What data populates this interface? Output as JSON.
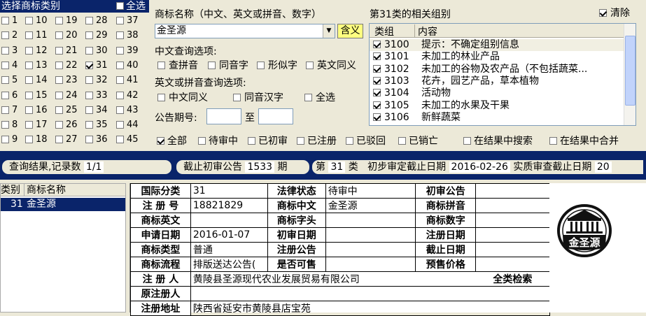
{
  "class_selector": {
    "header": "选择商标类别",
    "select_all": "全选",
    "classes": [
      "1",
      "2",
      "3",
      "4",
      "5",
      "6",
      "7",
      "8",
      "9",
      "10",
      "11",
      "12",
      "13",
      "14",
      "15",
      "16",
      "17",
      "18",
      "19",
      "20",
      "21",
      "22",
      "23",
      "24",
      "25",
      "26",
      "27",
      "28",
      "29",
      "30",
      "31",
      "32",
      "33",
      "34",
      "35",
      "36",
      "37",
      "38",
      "39",
      "40",
      "41",
      "42",
      "43",
      "44",
      "45"
    ],
    "checked_class": "31"
  },
  "query": {
    "name_label": "商标名称（中文、英文或拼音、数字）",
    "name_value": "金圣源",
    "meaning_button": "含义",
    "cn_options_label": "中文查询选项:",
    "cn_options": [
      "查拼音",
      "同音字",
      "形似字",
      "英文同义"
    ],
    "en_options_label": "英文或拼音查询选项:",
    "en_options": [
      "中文同义",
      "同音汉字",
      "全选"
    ],
    "issue_label": "公告期号:",
    "issue_to": "至"
  },
  "groups": {
    "title": "第31类的相关组别",
    "clear": "清除",
    "head_group": "类组",
    "head_content": "内容",
    "rows": [
      {
        "code": "3100",
        "text": "提示：不确定组别信息"
      },
      {
        "code": "3101",
        "text": "未加工的林业产品"
      },
      {
        "code": "3102",
        "text": "未加工的谷物及农产品（不包括蔬菜..."
      },
      {
        "code": "3103",
        "text": "花卉，园艺产品，草本植物"
      },
      {
        "code": "3104",
        "text": "活动物"
      },
      {
        "code": "3105",
        "text": "未加工的水果及干果"
      },
      {
        "code": "3106",
        "text": "新鲜蔬菜"
      }
    ]
  },
  "filters": [
    "全部",
    "待审中",
    "已初审",
    "已注册",
    "已驳回",
    "已销亡",
    "在结果中搜索",
    "在结果中合并"
  ],
  "statusbar": {
    "result_label": "查询结果,记录数",
    "result_value": "1/1",
    "cutoff_label": "截止初审公告",
    "cutoff_value": "1533",
    "cutoff_unit": "期",
    "class_prefix": "第",
    "class_value": "31",
    "class_suffix": "类",
    "prelim_label": "初步审定截止日期",
    "prelim_value": "2016-02-26",
    "subst_label": "实质审查截止日期",
    "subst_value": "20"
  },
  "results": {
    "head_class": "类别",
    "head_name": "商标名称",
    "row_class": "31",
    "row_name": "金圣源"
  },
  "detail": {
    "intl_class_k": "国际分类",
    "intl_class_v": "31",
    "legal_k": "法律状态",
    "legal_v": "待审中",
    "prelim_pub_k": "初审公告",
    "reg_no_k": "注 册 号",
    "reg_no_v": "18821829",
    "cn_k": "商标中文",
    "cn_v": "金圣源",
    "pinyin_k": "商标拼音",
    "en_k": "商标英文",
    "head_k": "商标字头",
    "num_k": "商标数字",
    "apply_k": "申请日期",
    "apply_v": "2016-01-07",
    "prelim_date_k": "初审日期",
    "reg_date_k": "注册日期",
    "type_k": "商标类型",
    "type_v": "普通",
    "reg_pub_k": "注册公告",
    "end_date_k": "截止日期",
    "flow_k": "商标流程",
    "flow_v": "排版送达公告(",
    "avail_k": "是否可售",
    "price_k": "预售价格",
    "reg_person_k": "注 册 人",
    "reg_person_v": "黄陵县圣源现代农业发展贸易有限公司",
    "full_search": "全类检索",
    "orig_reg_k": "原注册人",
    "addr_k": "注册地址",
    "addr_v": "陕西省延安市黄陵县店宝苑"
  },
  "logo": {
    "text": "金圣源"
  }
}
